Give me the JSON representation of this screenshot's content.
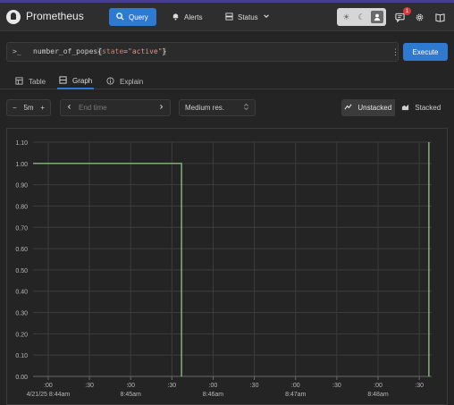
{
  "header": {
    "brand": "Prometheus",
    "nav": [
      {
        "label": "Query",
        "icon": "search-icon"
      },
      {
        "label": "Alerts",
        "icon": "bell-icon"
      },
      {
        "label": "Status",
        "icon": "server-icon"
      }
    ],
    "notification_count": "1"
  },
  "query": {
    "prompt": ">_",
    "metric": "number_of_popes",
    "label_name": "state",
    "operator": "=",
    "label_value": "\"active\"",
    "execute_label": "Execute"
  },
  "tabs": [
    {
      "label": "Table",
      "active": false
    },
    {
      "label": "Graph",
      "active": true
    },
    {
      "label": "Explain",
      "active": false
    }
  ],
  "controls": {
    "range_value": "5m",
    "minus": "−",
    "plus": "+",
    "end_time_placeholder": "End time",
    "resolution": "Medium res.",
    "unstacked_label": "Unstacked",
    "stacked_label": "Stacked",
    "stacked_mode": "unstacked"
  },
  "colors": {
    "accent": "#2f7ad1",
    "series": "#9bd48a",
    "badge": "#d63a3a"
  },
  "chart_data": {
    "type": "line",
    "title": "",
    "xlabel": "",
    "ylabel": "",
    "ylim": [
      0,
      1.1
    ],
    "y_ticks": [
      "0.00",
      "0.10",
      "0.20",
      "0.30",
      "0.40",
      "0.50",
      "0.60",
      "0.70",
      "0.80",
      "0.90",
      "1.00",
      "1.10"
    ],
    "x_ticks": [
      {
        "t": 0,
        "label": ":00",
        "sub": "4/21/25 8:44am"
      },
      {
        "t": 30,
        "label": ":30",
        "sub": ""
      },
      {
        "t": 60,
        "label": ":00",
        "sub": "8:45am"
      },
      {
        "t": 90,
        "label": ":30",
        "sub": ""
      },
      {
        "t": 120,
        "label": ":00",
        "sub": "8:46am"
      },
      {
        "t": 150,
        "label": ":30",
        "sub": ""
      },
      {
        "t": 180,
        "label": ":00",
        "sub": "8:47am"
      },
      {
        "t": 210,
        "label": ":30",
        "sub": ""
      },
      {
        "t": 240,
        "label": ":00",
        "sub": "8:48am"
      },
      {
        "t": 270,
        "label": ":30",
        "sub": ""
      }
    ],
    "x_range_seconds": [
      -11,
      279
    ],
    "series": [
      {
        "points": [
          [
            -11,
            1
          ],
          [
            97,
            1
          ],
          [
            97,
            0
          ]
        ]
      },
      {
        "points": [
          [
            277,
            0
          ],
          [
            277,
            1.1
          ]
        ]
      }
    ]
  }
}
